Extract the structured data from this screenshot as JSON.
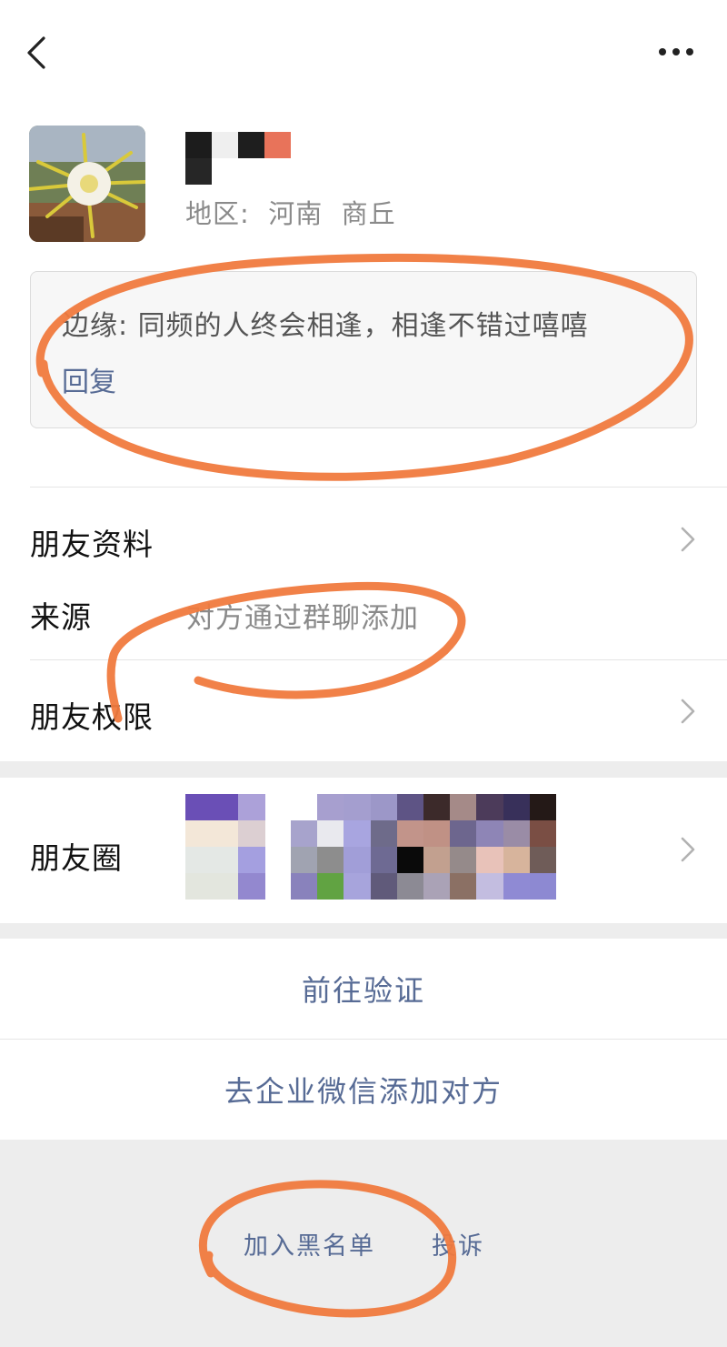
{
  "header": {
    "back_icon": "chevron-left-icon",
    "more_icon": "ellipsis-icon"
  },
  "profile": {
    "region": "地区:  河南  商丘"
  },
  "note": {
    "text": "边缘: 同频的人终会相逢，相逢不错过嘻嘻",
    "reply_label": "回复"
  },
  "rows": {
    "friend_info_label": "朋友资料",
    "source_label": "来源",
    "source_value": "对方通过群聊添加",
    "permissions_label": "朋友权限",
    "moments_label": "朋友圈"
  },
  "actions": {
    "verify_label": "前往验证",
    "wecom_label": "去企业微信添加对方"
  },
  "footer": {
    "blacklist_label": "加入黑名单",
    "report_label": "投诉"
  },
  "colors": {
    "link": "#576b95",
    "annotation": "#f07a3e",
    "background": "#ededed"
  }
}
